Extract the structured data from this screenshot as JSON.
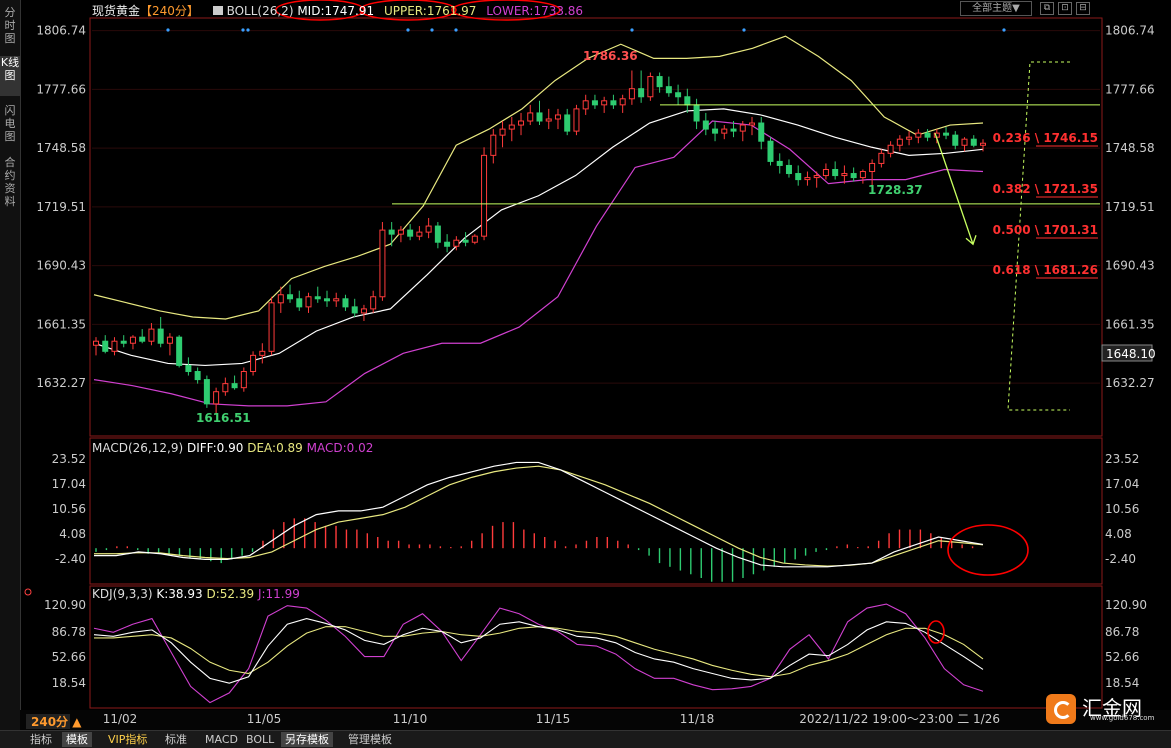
{
  "sidebar": {
    "tabs": [
      "分时图",
      "K线图",
      "闪电图",
      "合约资料"
    ]
  },
  "header": {
    "instrument": "现货黄金",
    "period": "【240分】",
    "boll_label": "BOLL(26,2)",
    "mid_label": "MID:1747.91",
    "upper_label": "UPPER:1761.97",
    "lower_label": "LOWER:1733.86",
    "theme_label": "全部主题▼",
    "win_icons": [
      "⧉",
      "⊡",
      "⊟"
    ]
  },
  "macd_header": {
    "label": "MACD(26,12,9)",
    "diff": "DIFF:0.90",
    "dea": "DEA:0.89",
    "macd": "MACD:0.02"
  },
  "kdj_header": {
    "label": "KDJ(9,3,3)",
    "k": "K:38.93",
    "d": "D:52.39",
    "j": "J:11.99"
  },
  "price_axis_labels": [
    "1806.74",
    "1777.66",
    "1748.58",
    "1719.51",
    "1690.43",
    "1661.35",
    "1632.27"
  ],
  "last_price_label": "1648.10",
  "annotations": {
    "high": "1786.36",
    "low": "1616.51",
    "swing_low": "1728.37"
  },
  "fib_levels": [
    {
      "label": "0.236 \\ 1746.15"
    },
    {
      "label": "0.382 \\ 1721.35"
    },
    {
      "label": "0.500 \\ 1701.31"
    },
    {
      "label": "0.618 \\ 1681.26"
    }
  ],
  "macd_axis_labels": [
    "23.52",
    "17.04",
    "10.56",
    "4.08",
    "-2.40"
  ],
  "kdj_axis_labels": [
    "120.90",
    "86.78",
    "52.66",
    "18.54"
  ],
  "period_badge": "240分 ▲",
  "date_labels": [
    {
      "label": "11/02"
    },
    {
      "label": "11/05"
    },
    {
      "label": "11/10"
    },
    {
      "label": "11/15"
    },
    {
      "label": "11/18"
    }
  ],
  "cursor_time": "2022/11/22 19:00～23:00 二 1/26",
  "bottom_tabs": [
    "指标",
    "模板",
    "VIP指标",
    "标准",
    "MACD",
    "BOLL",
    "另存模板",
    "管理模板"
  ],
  "logo": {
    "name": "汇金网",
    "url": "www.gold678.com"
  },
  "colors": {
    "bg": "#000000",
    "up": "#ff3b3b",
    "down": "#2ecc71",
    "upper_band": "#e8e880",
    "mid_band": "#ffffff",
    "lower_band": "#d040d0",
    "fib": "#ff3030",
    "annotation_circle": "#ff0000",
    "guide": "#c8ff60"
  },
  "chart_data": [
    {
      "type": "candlestick",
      "title": "现货黄金 240分",
      "y_ticks": [
        1806.74,
        1777.66,
        1748.58,
        1719.51,
        1690.43,
        1661.35,
        1632.27
      ],
      "ylim": [
        1614,
        1812
      ],
      "x_ticks": [
        "11/02",
        "11/05",
        "11/10",
        "11/15",
        "11/18"
      ],
      "candles": [
        [
          1651,
          1655,
          1646,
          1653
        ],
        [
          1653,
          1656,
          1647,
          1648
        ],
        [
          1648,
          1655,
          1646,
          1653
        ],
        [
          1653,
          1656,
          1650,
          1652
        ],
        [
          1652,
          1656,
          1649,
          1655
        ],
        [
          1655,
          1659,
          1652,
          1653
        ],
        [
          1653,
          1662,
          1651,
          1659
        ],
        [
          1659,
          1665,
          1650,
          1652
        ],
        [
          1652,
          1657,
          1646,
          1655
        ],
        [
          1655,
          1656,
          1640,
          1641
        ],
        [
          1641,
          1645,
          1636,
          1638
        ],
        [
          1638,
          1640,
          1632,
          1634
        ],
        [
          1634,
          1636,
          1620,
          1622
        ],
        [
          1622,
          1630,
          1617,
          1628
        ],
        [
          1628,
          1635,
          1626,
          1632
        ],
        [
          1632,
          1636,
          1629,
          1630
        ],
        [
          1630,
          1640,
          1628,
          1638
        ],
        [
          1638,
          1648,
          1636,
          1646
        ],
        [
          1646,
          1652,
          1642,
          1648
        ],
        [
          1648,
          1675,
          1646,
          1672
        ],
        [
          1672,
          1680,
          1667,
          1676
        ],
        [
          1676,
          1681,
          1672,
          1674
        ],
        [
          1674,
          1678,
          1668,
          1670
        ],
        [
          1670,
          1677,
          1667,
          1675
        ],
        [
          1675,
          1680,
          1672,
          1674
        ],
        [
          1674,
          1678,
          1670,
          1673
        ],
        [
          1673,
          1677,
          1670,
          1674
        ],
        [
          1674,
          1676,
          1668,
          1670
        ],
        [
          1670,
          1674,
          1665,
          1667
        ],
        [
          1667,
          1671,
          1663,
          1669
        ],
        [
          1669,
          1678,
          1667,
          1675
        ],
        [
          1675,
          1712,
          1673,
          1708
        ],
        [
          1708,
          1712,
          1700,
          1706
        ],
        [
          1706,
          1710,
          1702,
          1708
        ],
        [
          1708,
          1711,
          1703,
          1705
        ],
        [
          1705,
          1710,
          1703,
          1707
        ],
        [
          1707,
          1714,
          1704,
          1710
        ],
        [
          1710,
          1712,
          1699,
          1702
        ],
        [
          1702,
          1706,
          1697,
          1700
        ],
        [
          1700,
          1705,
          1698,
          1703
        ],
        [
          1703,
          1707,
          1700,
          1702
        ],
        [
          1702,
          1706,
          1701,
          1705
        ],
        [
          1705,
          1749,
          1703,
          1745
        ],
        [
          1745,
          1758,
          1741,
          1755
        ],
        [
          1755,
          1762,
          1749,
          1758
        ],
        [
          1758,
          1764,
          1752,
          1760
        ],
        [
          1760,
          1766,
          1755,
          1762
        ],
        [
          1762,
          1770,
          1760,
          1766
        ],
        [
          1766,
          1772,
          1760,
          1762
        ],
        [
          1762,
          1768,
          1758,
          1763
        ],
        [
          1763,
          1768,
          1758,
          1765
        ],
        [
          1765,
          1768,
          1755,
          1757
        ],
        [
          1757,
          1770,
          1755,
          1768
        ],
        [
          1768,
          1775,
          1765,
          1772
        ],
        [
          1772,
          1775,
          1768,
          1770
        ],
        [
          1770,
          1774,
          1766,
          1772
        ],
        [
          1772,
          1775,
          1768,
          1770
        ],
        [
          1770,
          1775,
          1766,
          1773
        ],
        [
          1773,
          1787,
          1770,
          1778
        ],
        [
          1778,
          1787,
          1771,
          1774
        ],
        [
          1774,
          1786,
          1772,
          1784
        ],
        [
          1784,
          1786,
          1776,
          1779
        ],
        [
          1779,
          1784,
          1774,
          1776
        ],
        [
          1776,
          1780,
          1770,
          1774
        ],
        [
          1774,
          1778,
          1766,
          1770
        ],
        [
          1770,
          1773,
          1758,
          1762
        ],
        [
          1762,
          1766,
          1755,
          1758
        ],
        [
          1758,
          1762,
          1752,
          1756
        ],
        [
          1756,
          1760,
          1753,
          1758
        ],
        [
          1758,
          1762,
          1754,
          1757
        ],
        [
          1757,
          1762,
          1752,
          1760
        ],
        [
          1760,
          1764,
          1755,
          1761
        ],
        [
          1761,
          1764,
          1748,
          1752
        ],
        [
          1752,
          1754,
          1740,
          1742
        ],
        [
          1742,
          1746,
          1736,
          1740
        ],
        [
          1740,
          1743,
          1734,
          1736
        ],
        [
          1736,
          1740,
          1730,
          1733
        ],
        [
          1733,
          1737,
          1730,
          1734
        ],
        [
          1734,
          1737,
          1729,
          1735
        ],
        [
          1735,
          1741,
          1733,
          1738
        ],
        [
          1738,
          1742,
          1733,
          1735
        ],
        [
          1735,
          1740,
          1731,
          1736
        ],
        [
          1736,
          1739,
          1732,
          1734
        ],
        [
          1734,
          1738,
          1731,
          1737
        ],
        [
          1737,
          1743,
          1728,
          1741
        ],
        [
          1741,
          1748,
          1739,
          1746
        ],
        [
          1746,
          1752,
          1744,
          1750
        ],
        [
          1750,
          1755,
          1747,
          1753
        ],
        [
          1753,
          1757,
          1750,
          1754
        ],
        [
          1754,
          1758,
          1751,
          1756
        ],
        [
          1756,
          1758,
          1752,
          1754
        ],
        [
          1754,
          1758,
          1751,
          1756
        ],
        [
          1756,
          1759,
          1753,
          1755
        ],
        [
          1755,
          1757,
          1748,
          1750
        ],
        [
          1750,
          1754,
          1747,
          1753
        ],
        [
          1753,
          1755,
          1749,
          1750
        ],
        [
          1750,
          1753,
          1747,
          1751
        ]
      ],
      "bands": {
        "upper": [
          1676,
          1672,
          1668,
          1665,
          1664,
          1668,
          1684,
          1690,
          1695,
          1701,
          1720,
          1750,
          1758,
          1768,
          1782,
          1793,
          1800,
          1793,
          1793,
          1794,
          1798,
          1804,
          1794,
          1782,
          1764,
          1755,
          1760,
          1761
        ],
        "mid": [
          1652,
          1646,
          1642,
          1641,
          1642,
          1647,
          1658,
          1665,
          1669,
          1686,
          1704,
          1718,
          1725,
          1735,
          1749,
          1761,
          1767,
          1768,
          1765,
          1760,
          1754,
          1749,
          1745,
          1746,
          1748
        ],
        "lower": [
          1634,
          1631,
          1627,
          1622,
          1621,
          1621,
          1623,
          1637,
          1647,
          1652,
          1652,
          1660,
          1675,
          1710,
          1739,
          1744,
          1762,
          1760,
          1748,
          1731,
          1733,
          1733,
          1738,
          1737
        ]
      },
      "guides": {
        "horizontal": [
          1770,
          1721
        ],
        "fib_ratios": [
          0.236,
          0.382,
          0.5,
          0.618
        ]
      }
    },
    {
      "type": "macd",
      "y_ticks": [
        23.52,
        17.04,
        10.56,
        4.08,
        -2.4
      ],
      "diff": [
        -2,
        -2,
        -1,
        -1.5,
        -2.5,
        -3,
        -3,
        -2,
        2,
        6,
        9,
        10,
        10,
        11,
        14,
        17,
        19,
        20.5,
        22,
        23,
        23,
        21,
        18,
        15,
        12,
        9,
        6,
        3,
        0,
        -2.5,
        -4.5,
        -5,
        -5,
        -5,
        -4.5,
        -4,
        -1,
        1,
        3,
        2,
        1
      ],
      "dea": [
        -1.5,
        -1.5,
        -1.2,
        -1.3,
        -2,
        -2.5,
        -2.8,
        -2.5,
        -1,
        2,
        5,
        7,
        8,
        9,
        11,
        14,
        17,
        19,
        20.5,
        21.5,
        22,
        21,
        19,
        17,
        14.5,
        12,
        9,
        6,
        3,
        0,
        -2.5,
        -4,
        -4.5,
        -4.8,
        -4.6,
        -4,
        -2,
        0,
        2,
        1.5,
        0.9
      ],
      "hist": [
        -1,
        -0.5,
        0.5,
        0.5,
        -0.5,
        -1.5,
        -1.5,
        -2,
        -2,
        -2.5,
        -3,
        -3.5,
        -4,
        -3,
        -2,
        -1,
        2,
        5,
        7,
        8,
        8,
        7,
        6,
        6,
        5,
        5,
        4,
        3,
        2,
        2,
        1,
        1,
        1,
        0.5,
        0.3,
        0.5,
        2,
        4,
        6,
        7,
        7,
        5,
        4,
        3,
        2,
        0.5,
        1,
        2,
        3,
        3,
        2,
        1,
        -0.5,
        -2,
        -4,
        -5,
        -6,
        -7,
        -8,
        -9,
        -9,
        -9,
        -8,
        -7,
        -6,
        -5,
        -4,
        -3,
        -2,
        -1,
        -0.5,
        0.5,
        1,
        0.3,
        0.5,
        2,
        4,
        5,
        5,
        5,
        4,
        3,
        2,
        1,
        0.5,
        0.02
      ]
    },
    {
      "type": "kdj",
      "y_ticks": [
        120.9,
        86.78,
        52.66,
        18.54
      ],
      "k": [
        82,
        80,
        85,
        88,
        72,
        48,
        28,
        22,
        30,
        68,
        95,
        102,
        96,
        88,
        75,
        70,
        82,
        90,
        86,
        72,
        78,
        95,
        98,
        92,
        88,
        80,
        78,
        72,
        60,
        52,
        48,
        40,
        34,
        28,
        26,
        28,
        44,
        58,
        56,
        70,
        88,
        98,
        96,
        85,
        70,
        55,
        39
      ],
      "d": [
        78,
        78,
        80,
        82,
        78,
        65,
        48,
        38,
        34,
        48,
        68,
        84,
        92,
        92,
        86,
        80,
        80,
        84,
        86,
        82,
        80,
        84,
        90,
        92,
        90,
        86,
        84,
        80,
        72,
        64,
        58,
        52,
        44,
        38,
        33,
        30,
        34,
        44,
        50,
        58,
        70,
        82,
        90,
        90,
        82,
        70,
        52
      ],
      "j": [
        90,
        85,
        95,
        102,
        60,
        18,
        -2,
        10,
        40,
        105,
        118,
        115,
        100,
        80,
        55,
        55,
        95,
        108,
        86,
        50,
        82,
        115,
        108,
        95,
        86,
        70,
        68,
        58,
        40,
        28,
        28,
        20,
        14,
        15,
        18,
        28,
        64,
        82,
        52,
        98,
        115,
        120,
        108,
        78,
        40,
        20,
        12
      ]
    }
  ]
}
